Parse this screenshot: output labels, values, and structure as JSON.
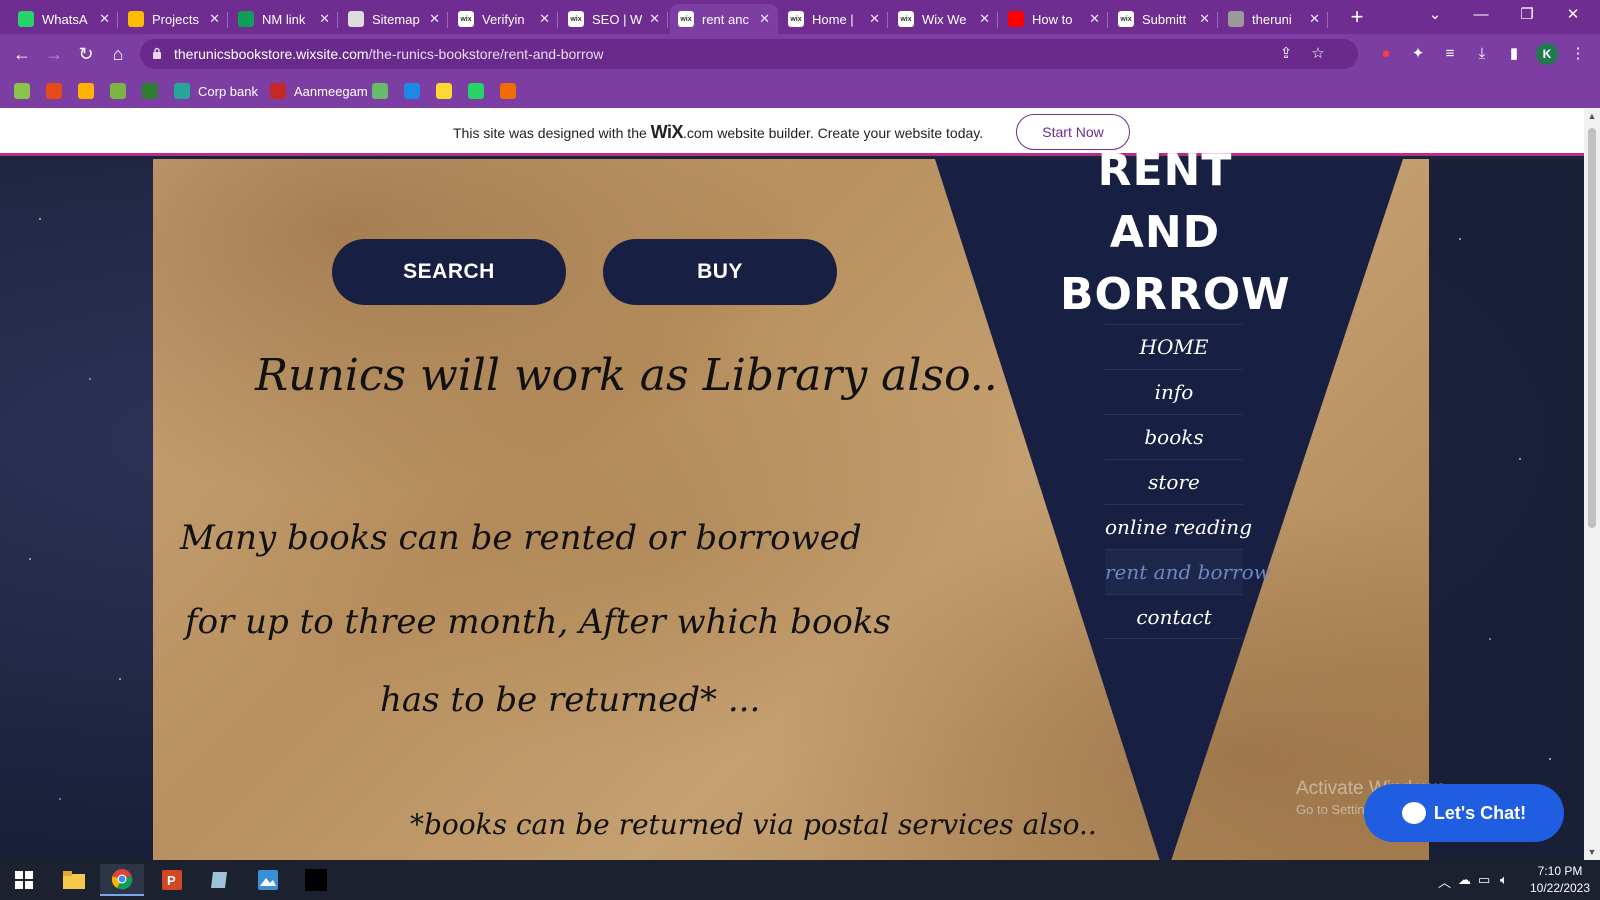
{
  "browser": {
    "tabs": [
      {
        "title": "WhatsA",
        "icon": "whatsapp-icon",
        "color": "#25d366",
        "close": "✕"
      },
      {
        "title": "Projects",
        "icon": "google-drive-icon",
        "color": "#fbbc04",
        "close": "✕"
      },
      {
        "title": "NM link",
        "icon": "google-sheets-icon",
        "color": "#0f9d58",
        "close": "✕"
      },
      {
        "title": "Sitemap",
        "icon": "sitemap-icon",
        "color": "#dddddd",
        "close": "✕"
      },
      {
        "title": "Verifyin",
        "icon": "wix-icon",
        "color": "#ffffff",
        "close": "✕"
      },
      {
        "title": "SEO | W",
        "icon": "wix-icon",
        "color": "#ffffff",
        "close": "✕"
      },
      {
        "title": "rent anc",
        "icon": "wix-icon",
        "color": "#ffffff",
        "close": "✕",
        "active": true
      },
      {
        "title": "Home |",
        "icon": "wix-icon",
        "color": "#ffffff",
        "close": "✕"
      },
      {
        "title": "Wix We",
        "icon": "wix-icon",
        "color": "#ffffff",
        "close": "✕"
      },
      {
        "title": "How to",
        "icon": "youtube-icon",
        "color": "#ff0000",
        "close": "✕"
      },
      {
        "title": "Submitt",
        "icon": "wix-icon",
        "color": "#ffffff",
        "close": "✕"
      },
      {
        "title": "theruni",
        "icon": "globe-icon",
        "color": "#9a9a9a",
        "close": "✕"
      }
    ],
    "url_host": "therunicsbookstore.wixsite.com",
    "url_path": "/the-runics-bookstore/rent-and-borrow",
    "profile_initial": "K",
    "bookmarks": [
      {
        "label": "",
        "color": "#8bc34a"
      },
      {
        "label": "",
        "color": "#e64a19"
      },
      {
        "label": "",
        "color": "#ffb300"
      },
      {
        "label": "",
        "color": "#7cb342"
      },
      {
        "label": "",
        "color": "#2e7d32"
      },
      {
        "label": "Corp bank",
        "color": "#26a69a"
      },
      {
        "label": "Aanmeegam",
        "color": "#c62828"
      },
      {
        "label": "",
        "color": "#66bb6a"
      },
      {
        "label": "",
        "color": "#1e88e5"
      },
      {
        "label": "",
        "color": "#fdd835"
      },
      {
        "label": "",
        "color": "#25d366"
      },
      {
        "label": "",
        "color": "#ef6c00"
      }
    ]
  },
  "wix_banner": {
    "prefix": "This site was designed with the ",
    "logo": "WiX",
    "suffix": ".com website builder. Create your website today.",
    "button": "Start Now"
  },
  "site": {
    "title_lines": [
      "RENT",
      "AND",
      "BORROW"
    ],
    "nav": [
      {
        "label": "HOME"
      },
      {
        "label": "info"
      },
      {
        "label": "books"
      },
      {
        "label": "store"
      },
      {
        "label": "online reading"
      },
      {
        "label": "rent and borrow",
        "current": true
      },
      {
        "label": "contact"
      }
    ],
    "buttons": {
      "search": "SEARCH",
      "buy": "BUY"
    },
    "text": {
      "line1": "Runics will work as Library also..",
      "line2": "Many books can be rented or borrowed",
      "line3": "for up to three month, After which books",
      "line4": "has to be returned* ...",
      "line5": "*books can be returned via postal services also.."
    },
    "chat": "Let's Chat!"
  },
  "windows": {
    "watermark_title": "Activate Windows",
    "watermark_sub": "Go to Settings to activate Windows.",
    "time": "7:10 PM",
    "date": "10/22/2023"
  }
}
